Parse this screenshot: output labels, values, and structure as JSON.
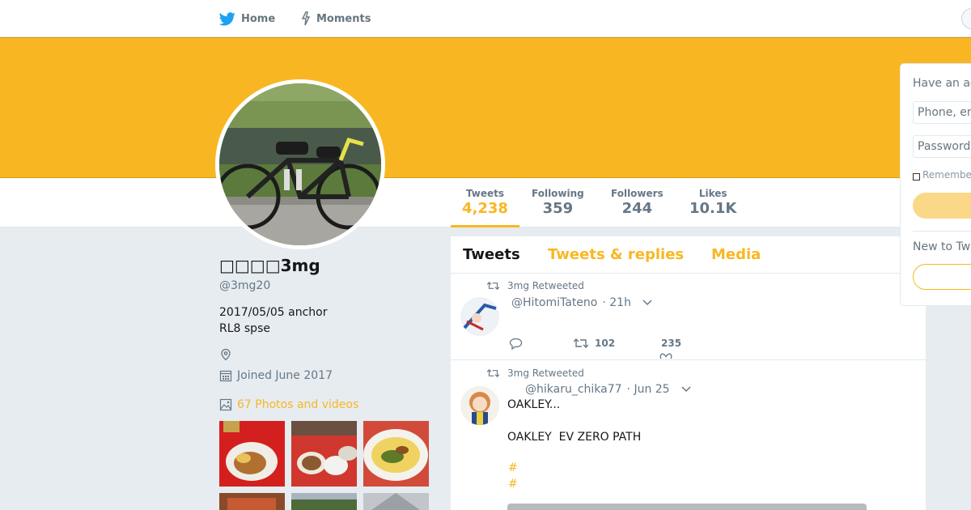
{
  "nav": {
    "home_label": "Home",
    "moments_label": "Moments"
  },
  "colors": {
    "brand": "#f8b722",
    "text_secondary": "#657786",
    "background": "#e6ecf0"
  },
  "stats": {
    "tweets_label": "Tweets",
    "tweets_value": "4,238",
    "following_label": "Following",
    "following_value": "359",
    "followers_label": "Followers",
    "followers_value": "244",
    "likes_label": "Likes",
    "likes_value": "10.1K"
  },
  "profile": {
    "name": "□□□□3mg",
    "handle": "@3mg20",
    "bio_line1": "2017/05/05 anchor",
    "bio_line2": "RL8 spse",
    "joined": "Joined June 2017",
    "photos_link": "67 Photos and videos"
  },
  "tabs": {
    "tweets": "Tweets",
    "replies": "Tweets & replies",
    "media": "Media"
  },
  "tweets": [
    {
      "context": "3mg Retweeted",
      "handle": "@HitomiTateno",
      "time": "· 21h",
      "retweets": "102",
      "likes": "235"
    },
    {
      "context": "3mg Retweeted",
      "handle": "@hikaru_chika77",
      "time": "· Jun 25",
      "text_line1": "OAKLEY...",
      "text_line2": "OAKLEY  EV ZERO PATH",
      "hashtag1": "#",
      "hashtag2": "#"
    }
  ],
  "login": {
    "title": "Have an account?",
    "phone_placeholder": "Phone, email or username",
    "password_placeholder": "Password",
    "remember": "Remember me"
  },
  "signup": {
    "prompt": "New to Twitter?"
  }
}
